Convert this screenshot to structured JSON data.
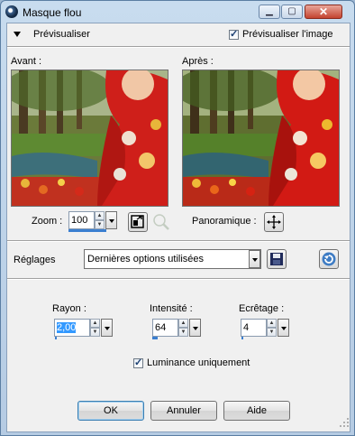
{
  "window": {
    "title": "Masque flou"
  },
  "preview_section": {
    "label": "Prévisualiser",
    "checkbox_label": "Prévisualiser l'image",
    "checked": true
  },
  "before_label": "Avant :",
  "after_label": "Après :",
  "zoom": {
    "label": "Zoom :",
    "value": "100"
  },
  "pan_label": "Panoramique :",
  "settings": {
    "label": "Réglages",
    "value": "Dernières options utilisées"
  },
  "params": {
    "radius": {
      "label": "Rayon :",
      "value": "2,00"
    },
    "strength": {
      "label": "Intensité :",
      "value": "64"
    },
    "clipping": {
      "label": "Ecrêtage :",
      "value": "4"
    }
  },
  "luminance": {
    "label": "Luminance uniquement",
    "checked": true
  },
  "buttons": {
    "ok": "OK",
    "cancel": "Annuler",
    "help": "Aide"
  },
  "colors": {
    "accent": "#3b7fd0",
    "title_bar": "#c8dcef"
  }
}
